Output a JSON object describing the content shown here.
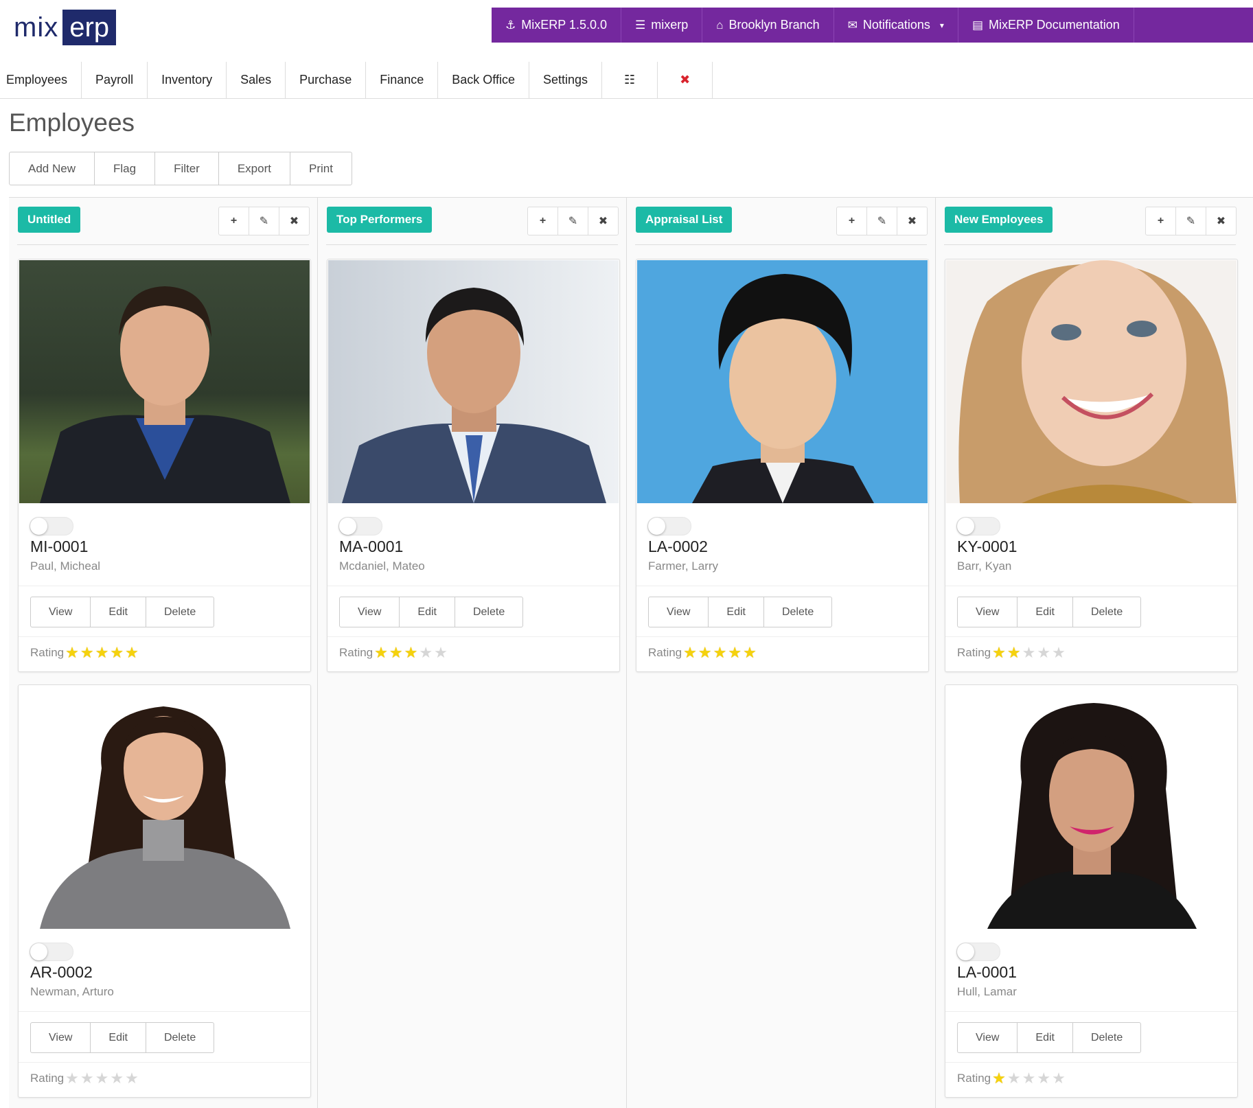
{
  "app": {
    "logo_part1": "mix",
    "logo_part2": "erp"
  },
  "topbar": [
    {
      "icon": "anchor-icon",
      "glyph": "⚓",
      "label": "MixERP 1.5.0.0"
    },
    {
      "icon": "database-icon",
      "glyph": "☰",
      "label": "mixerp"
    },
    {
      "icon": "home-icon",
      "glyph": "⌂",
      "label": "Brooklyn Branch"
    },
    {
      "icon": "envelope-icon",
      "glyph": "✉",
      "label": "Notifications",
      "caret": "▾"
    },
    {
      "icon": "book-icon",
      "glyph": "▤",
      "label": "MixERP Documentation"
    }
  ],
  "nav": {
    "items": [
      "Employees",
      "Payroll",
      "Inventory",
      "Sales",
      "Purchase",
      "Finance",
      "Back Office",
      "Settings"
    ],
    "sliders_glyph": "☷",
    "close_glyph": "✖"
  },
  "page": {
    "title": "Employees"
  },
  "toolbar": {
    "add_new": "Add New",
    "flag": "Flag",
    "filter": "Filter",
    "export": "Export",
    "print": "Print"
  },
  "column_actions": {
    "add": "+",
    "edit": "✎",
    "remove": "✖"
  },
  "card_buttons": {
    "view": "View",
    "edit": "Edit",
    "delete": "Delete"
  },
  "rating_label": "Rating",
  "colors": {
    "topbar": "#74289e",
    "accent": "#1cbaa6",
    "logo": "#1f2a6b",
    "star": "#f5d20d"
  },
  "columns": [
    {
      "title": "Untitled",
      "cards": [
        {
          "code": "MI-0001",
          "name": "Paul, Micheal",
          "rating": 5
        },
        {
          "code": "AR-0002",
          "name": "Newman, Arturo",
          "rating": 0
        }
      ]
    },
    {
      "title": "Top Performers",
      "cards": [
        {
          "code": "MA-0001",
          "name": "Mcdaniel, Mateo",
          "rating": 3
        }
      ]
    },
    {
      "title": "Appraisal List",
      "cards": [
        {
          "code": "LA-0002",
          "name": "Farmer, Larry",
          "rating": 5
        }
      ]
    },
    {
      "title": "New Employees",
      "cards": [
        {
          "code": "KY-0001",
          "name": "Barr, Kyan",
          "rating": 2
        },
        {
          "code": "LA-0001",
          "name": "Hull, Lamar",
          "rating": 1
        }
      ]
    }
  ]
}
